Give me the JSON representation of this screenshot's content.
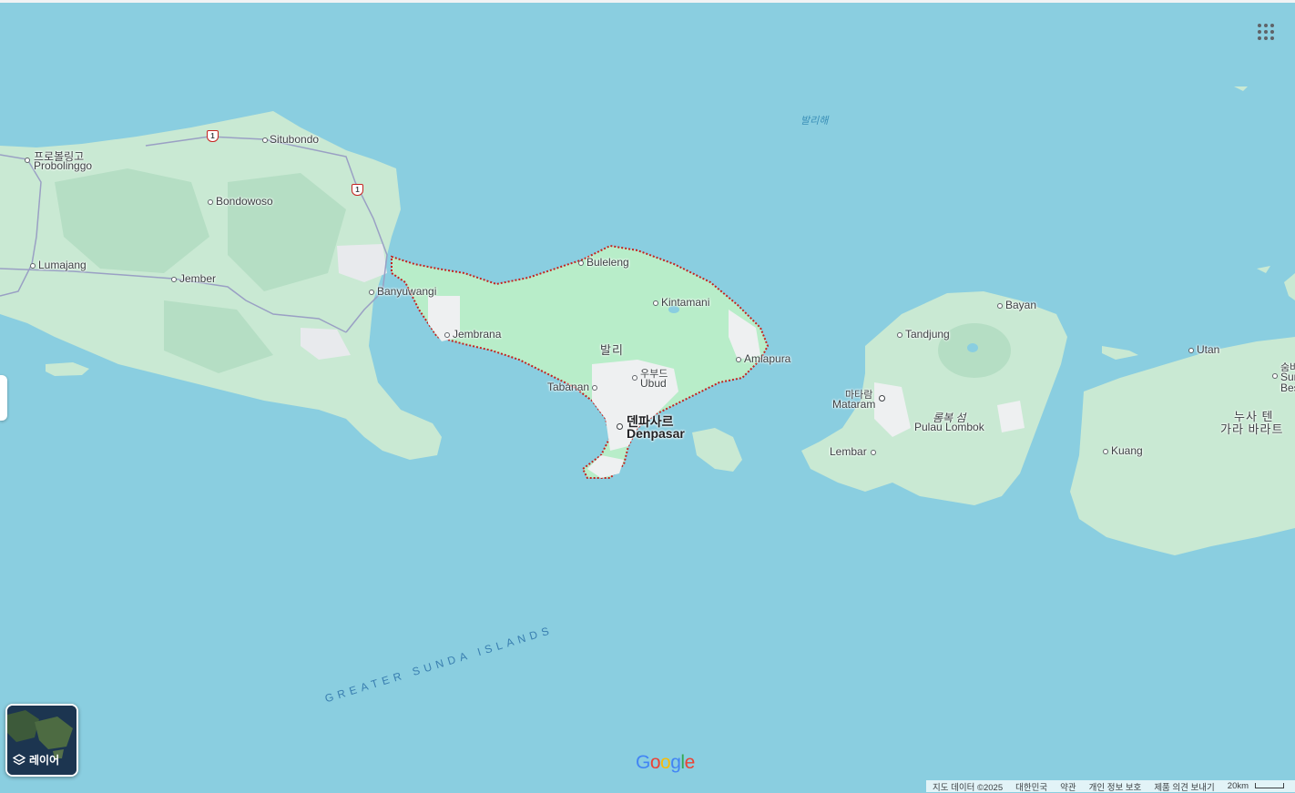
{
  "map": {
    "water_label": "발리해",
    "region_label": "GREATER SUNDA ISLANDS",
    "places": {
      "probolinggo_ko": "프로볼링고",
      "probolinggo": "Probolinggo",
      "situbondo": "Situbondo",
      "bondowoso": "Bondowoso",
      "lumajang": "Lumajang",
      "jember": "Jember",
      "banyuwangi": "Banyuwangi",
      "buleleng": "Buleleng",
      "kintamani": "Kintamani",
      "jembrana": "Jembrana",
      "bali_ko": "발리",
      "amlapura": "Amlapura",
      "tabanan": "Tabanan",
      "ubud_ko": "우부드",
      "ubud": "Ubud",
      "denpasar_ko": "덴파사르",
      "denpasar": "Denpasar",
      "bayan": "Bayan",
      "tandjung": "Tandjung",
      "mataram_ko": "마타람",
      "mataram": "Mataram",
      "lombok_ko": "롬복 섬",
      "lombok": "Pulau Lombok",
      "lembar": "Lembar",
      "utan": "Utan",
      "kuang": "Kuang",
      "nusa_line1": "누사 텐",
      "nusa_line2": "가라 바라트",
      "edge_ko": "숨바",
      "edge_1": "Sum",
      "edge_2": "Bes"
    },
    "route_number": "1"
  },
  "controls": {
    "layer_label": "레이어",
    "google_logo": "Google"
  },
  "footer": {
    "map_data": "지도 데이터 ©2025",
    "country": "대한민국",
    "terms": "약관",
    "privacy": "개인 정보 보호",
    "feedback": "제품 의견 보내기",
    "scale": "20km"
  },
  "colors": {
    "water": "#8ACEE0",
    "land": "#C9E9D3",
    "bali_land": "#B8EDC9",
    "border": "#C5221F"
  }
}
